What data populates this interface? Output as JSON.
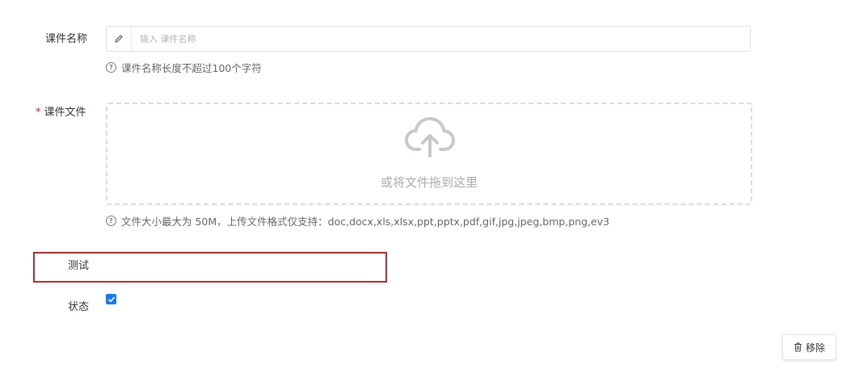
{
  "form": {
    "name": {
      "label": "课件名称",
      "placeholder": "输入 课件名称",
      "value": "",
      "hint": "课件名称长度不超过100个字符"
    },
    "file": {
      "required_mark": "*",
      "label": "课件文件",
      "drop_text": "或将文件拖到这里",
      "hint": "文件大小最大为 50M，上传文件格式仅支持：doc,docx,xls,xlsx,ppt,pptx,pdf,gif,jpg,jpeg,bmp,png,ev3"
    },
    "test": {
      "label": "测试"
    },
    "status": {
      "label": "状态",
      "checked": true
    }
  },
  "actions": {
    "remove_label": "移除"
  },
  "icons": {
    "name_prefix": "pencil-icon",
    "upload": "cloud-upload-icon",
    "hint": "question-circle-icon",
    "remove": "trash-icon"
  },
  "colors": {
    "required": "#e02020",
    "highlight_border": "#c0292a",
    "checkbox": "#1677ff"
  }
}
